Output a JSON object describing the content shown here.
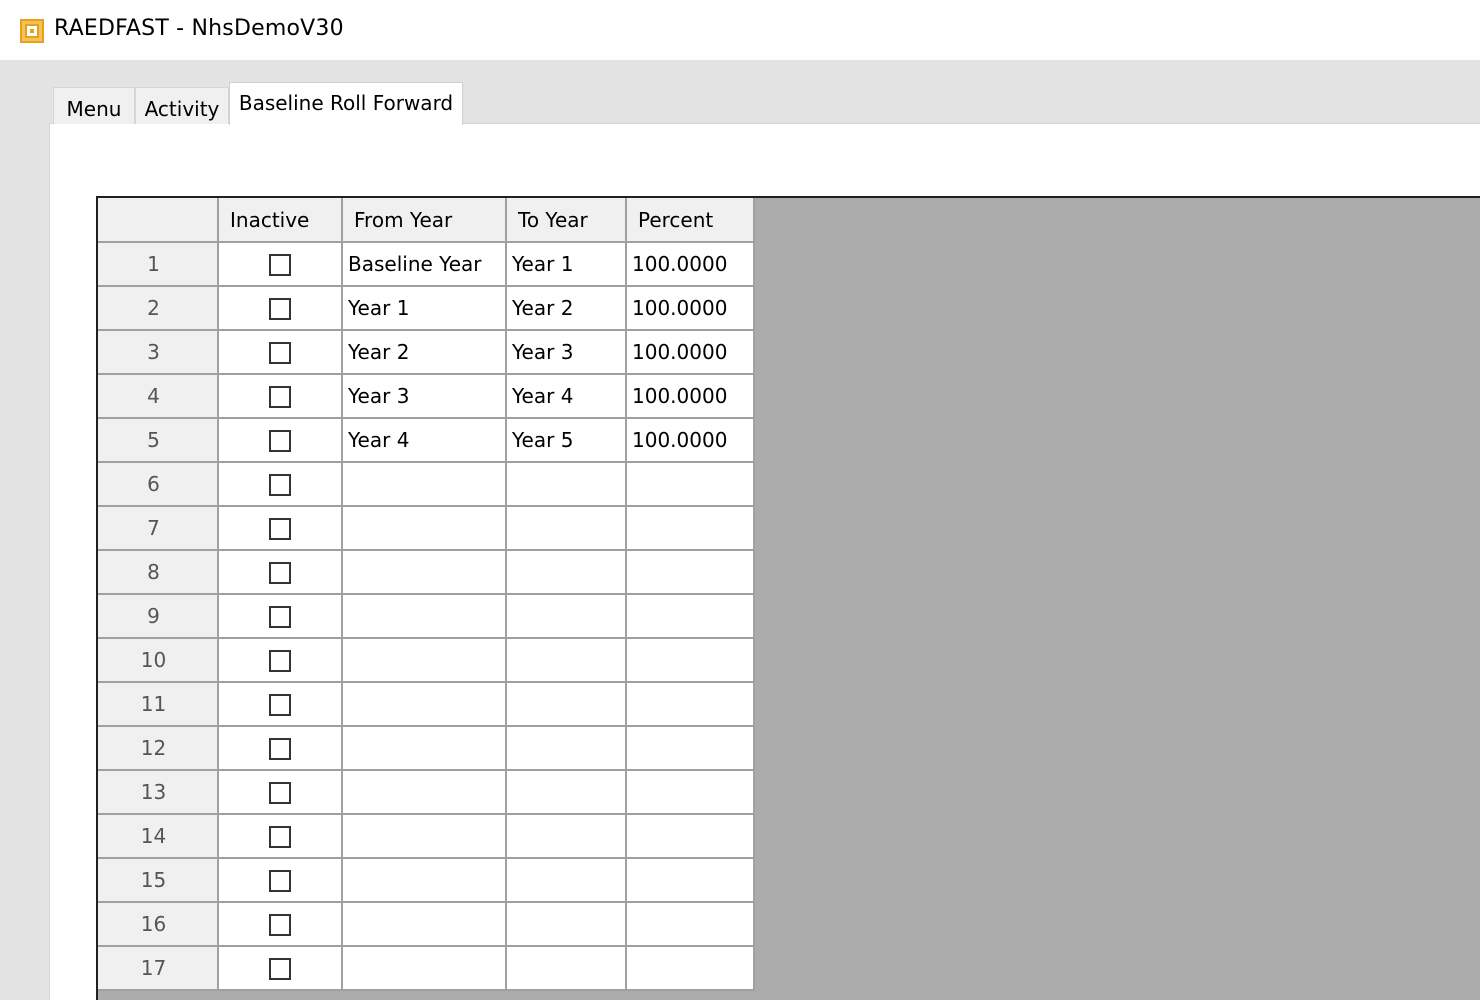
{
  "window": {
    "title": "RAEDFAST - NhsDemoV30",
    "icon": "app-logo-icon",
    "accent_color": "#e8a21a"
  },
  "tabs": [
    {
      "label": "Menu",
      "active": false
    },
    {
      "label": "Activity",
      "active": false
    },
    {
      "label": "Baseline Roll Forward",
      "active": true
    }
  ],
  "grid": {
    "columns": [
      "Inactive",
      "From Year",
      "To Year",
      "Percent"
    ],
    "rows": [
      {
        "num": "1",
        "inactive": false,
        "from_year": "Baseline Year",
        "to_year": "Year 1",
        "percent": "100.0000"
      },
      {
        "num": "2",
        "inactive": false,
        "from_year": "Year 1",
        "to_year": "Year 2",
        "percent": "100.0000"
      },
      {
        "num": "3",
        "inactive": false,
        "from_year": "Year 2",
        "to_year": "Year 3",
        "percent": "100.0000"
      },
      {
        "num": "4",
        "inactive": false,
        "from_year": "Year 3",
        "to_year": "Year 4",
        "percent": "100.0000"
      },
      {
        "num": "5",
        "inactive": false,
        "from_year": "Year 4",
        "to_year": "Year 5",
        "percent": "100.0000"
      },
      {
        "num": "6",
        "inactive": false,
        "from_year": "",
        "to_year": "",
        "percent": ""
      },
      {
        "num": "7",
        "inactive": false,
        "from_year": "",
        "to_year": "",
        "percent": ""
      },
      {
        "num": "8",
        "inactive": false,
        "from_year": "",
        "to_year": "",
        "percent": ""
      },
      {
        "num": "9",
        "inactive": false,
        "from_year": "",
        "to_year": "",
        "percent": ""
      },
      {
        "num": "10",
        "inactive": false,
        "from_year": "",
        "to_year": "",
        "percent": ""
      },
      {
        "num": "11",
        "inactive": false,
        "from_year": "",
        "to_year": "",
        "percent": ""
      },
      {
        "num": "12",
        "inactive": false,
        "from_year": "",
        "to_year": "",
        "percent": ""
      },
      {
        "num": "13",
        "inactive": false,
        "from_year": "",
        "to_year": "",
        "percent": ""
      },
      {
        "num": "14",
        "inactive": false,
        "from_year": "",
        "to_year": "",
        "percent": ""
      },
      {
        "num": "15",
        "inactive": false,
        "from_year": "",
        "to_year": "",
        "percent": ""
      },
      {
        "num": "16",
        "inactive": false,
        "from_year": "",
        "to_year": "",
        "percent": ""
      },
      {
        "num": "17",
        "inactive": false,
        "from_year": "",
        "to_year": "",
        "percent": ""
      }
    ]
  }
}
